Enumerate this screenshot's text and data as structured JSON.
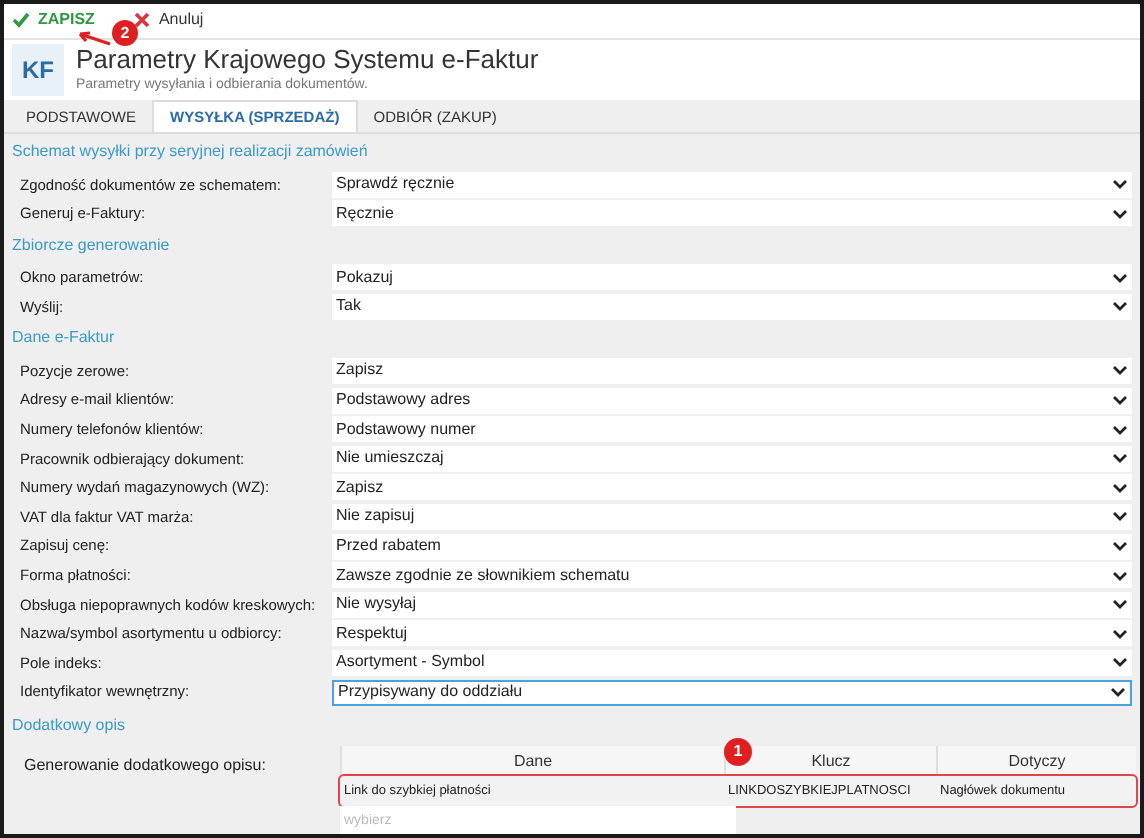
{
  "toolbar": {
    "buttons": [
      {
        "kind": "save",
        "label": "ZAPISZ"
      },
      {
        "kind": "cancel",
        "label": "Anuluj"
      }
    ]
  },
  "header": {
    "badge": "KF",
    "title": "Parametry Krajowego Systemu e-Faktur",
    "subtitle": "Parametry wysyłania i odbierania dokumentów."
  },
  "tabs": [
    {
      "label": "PODSTAWOWE",
      "selected": false
    },
    {
      "label": "WYSYŁKA (SPRZEDAŻ)",
      "selected": true
    },
    {
      "label": "ODBIÓR (ZAKUP)",
      "selected": false
    }
  ],
  "sections": [
    {
      "title": "Schemat wysyłki przy seryjnej realizacji zamówień",
      "fields": [
        {
          "label": "Zgodność dokumentów ze schematem:",
          "value": "Sprawdź ręcznie",
          "focused": false
        },
        {
          "label": "Generuj e-Faktury:",
          "value": "Ręcznie",
          "focused": false
        }
      ]
    },
    {
      "title": "Zbiorcze generowanie",
      "fields": [
        {
          "label": "Okno parametrów:",
          "value": "Pokazuj",
          "focused": false
        },
        {
          "label": "Wyślij:",
          "value": "Tak",
          "focused": false
        }
      ]
    },
    {
      "title": "Dane e-Faktur",
      "fields": [
        {
          "label": "Pozycje zerowe:",
          "value": "Zapisz",
          "focused": false
        },
        {
          "label": "Adresy e-mail klientów:",
          "value": "Podstawowy adres",
          "focused": false
        },
        {
          "label": "Numery telefonów klientów:",
          "value": "Podstawowy numer",
          "focused": false
        },
        {
          "label": "Pracownik odbierający dokument:",
          "value": "Nie umieszczaj",
          "focused": false
        },
        {
          "label": "Numery wydań magazynowych (WZ):",
          "value": "Zapisz",
          "focused": false
        },
        {
          "label": "VAT dla faktur VAT marża:",
          "value": "Nie zapisuj",
          "focused": false
        },
        {
          "label": "Zapisuj cenę:",
          "value": "Przed rabatem",
          "focused": false
        },
        {
          "label": "Forma płatności:",
          "value": "Zawsze zgodnie ze słownikiem schematu",
          "focused": false
        },
        {
          "label": "Obsługa niepoprawnych kodów kreskowych:",
          "value": "Nie wysyłaj",
          "focused": false
        },
        {
          "label": "Nazwa/symbol asortymentu u odbiorcy:",
          "value": "Respektuj",
          "focused": false
        },
        {
          "label": "Pole indeks:",
          "value": "Asortyment - Symbol",
          "focused": false
        },
        {
          "label": "Identyfikator wewnętrzny:",
          "value": "Przypisywany do oddziału",
          "focused": true
        }
      ]
    }
  ],
  "extra": {
    "title": "Dodatkowy opis",
    "label": "Generowanie dodatkowego opisu:",
    "table": {
      "columns": [
        "Dane",
        "Klucz",
        "Dotyczy"
      ],
      "rows": [
        {
          "cells": [
            "Link do szybkiej płatności",
            "LINKDOSZYBKIEJPLATNOSCI",
            "Nagłówek dokumentu"
          ],
          "highlighted": true
        }
      ],
      "new_row": {
        "placeholder": "wybierz"
      }
    }
  },
  "callouts": [
    {
      "label": "2"
    },
    {
      "label": "1"
    }
  ]
}
